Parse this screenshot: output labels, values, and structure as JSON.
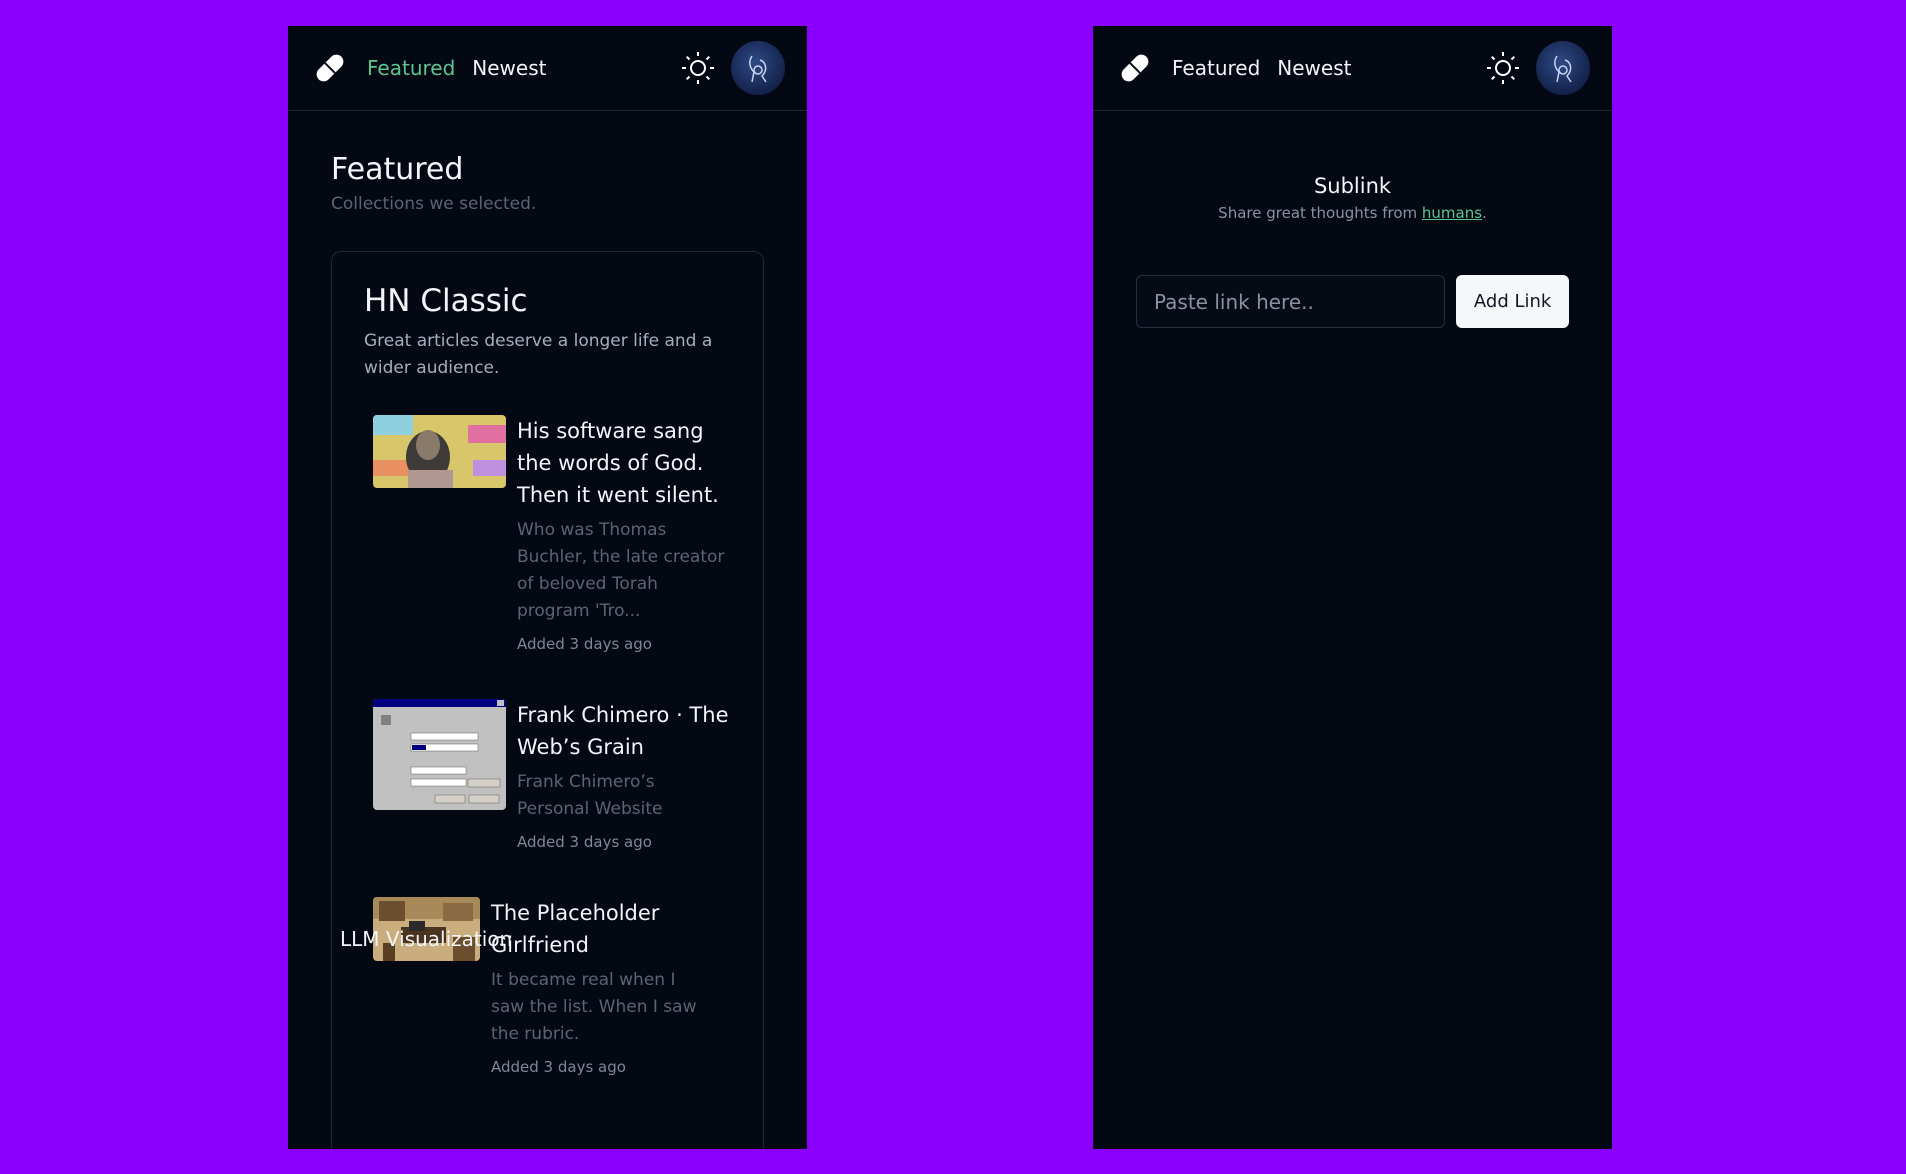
{
  "left": {
    "nav": {
      "featured_label": "Featured",
      "newest_label": "Newest"
    },
    "header": {
      "title": "Featured",
      "subtitle": "Collections we selected."
    },
    "collection": {
      "title": "HN Classic",
      "description": "Great articles deserve a longer life and a wider audience.",
      "articles": [
        {
          "title": "His software sang the words of God. Then it went silent.",
          "description": "Who was Thomas Buchler, the late creator of beloved Torah program 'Tro...",
          "meta": "Added 3 days ago"
        },
        {
          "title": "Frank Chimero · The Web’s Grain",
          "description": "Frank Chimero’s Personal Website",
          "meta": "Added 3 days ago"
        },
        {
          "title": "The Placeholder Girlfriend",
          "description": "It became real when I saw the list. When I saw the rubric.",
          "meta": "Added 3 days ago"
        }
      ]
    },
    "next_collection": "LLM Visualization"
  },
  "right": {
    "nav": {
      "featured_label": "Featured",
      "newest_label": "Newest"
    },
    "hero": {
      "title": "Sublink",
      "tagline_prefix": "Share great thoughts from ",
      "tagline_link": "humans",
      "tagline_suffix": "."
    },
    "form": {
      "placeholder": "Paste link here..",
      "button_label": "Add Link"
    }
  },
  "icons": {
    "logo": "pill-icon",
    "theme": "sun-icon",
    "avatar": "user-avatar"
  },
  "colors": {
    "background": "#8b00ff",
    "screen": "#040812",
    "accent": "#5ec48e",
    "button": "#f6f7f9"
  }
}
